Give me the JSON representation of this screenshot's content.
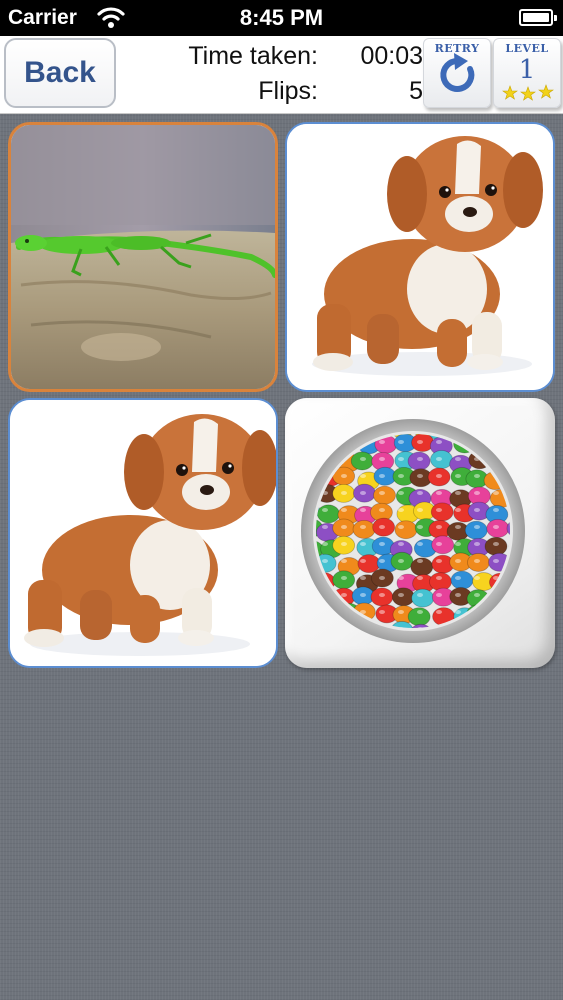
{
  "status_bar": {
    "carrier": "Carrier",
    "time": "8:45 PM",
    "wifi_icon": "wifi-icon",
    "battery_level": 1.0
  },
  "header": {
    "back_label": "Back",
    "time_label": "Time taken:",
    "time_value": "00:03",
    "flips_label": "Flips:",
    "flips_value": "5",
    "retry_caption": "RETRY",
    "retry_icon": "refresh-icon",
    "level_caption": "LEVEL",
    "level_value": "1",
    "level_stars": 3
  },
  "cards": [
    {
      "image": "lizard-on-log",
      "state": "revealed",
      "highlight": "#d9833c"
    },
    {
      "image": "puppy",
      "state": "revealed",
      "highlight": "#5c8ed2"
    },
    {
      "image": "puppy",
      "state": "revealed",
      "highlight": "#5c8ed2"
    },
    {
      "image": "candy-bowl",
      "state": "face-down"
    }
  ],
  "colors": {
    "accent_blue": "#34548c",
    "selected_border": "#d9833c",
    "matched_border": "#5c8ed2",
    "background": "#6e737b"
  }
}
